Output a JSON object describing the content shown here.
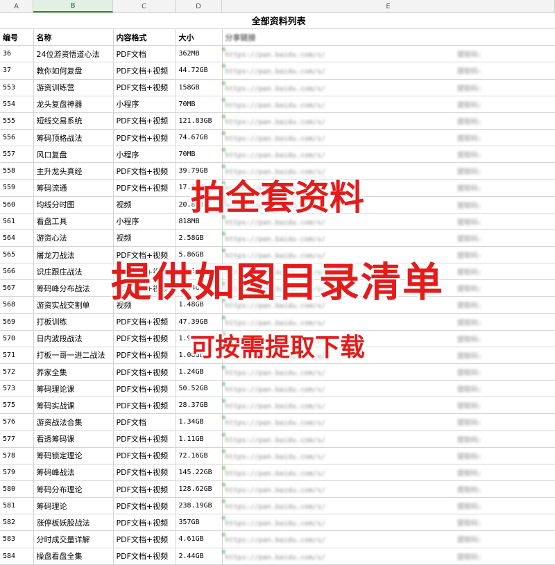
{
  "sheet": {
    "column_headers": [
      "A",
      "B",
      "C",
      "D",
      "E"
    ],
    "selected_column": "B",
    "title": "全部资料列表",
    "headers": [
      "编号",
      "名称",
      "内容格式",
      "大小",
      "分享链接"
    ],
    "link_prefix": "https://pan.baidu.com/s/",
    "code_label": "提取码:",
    "rows": [
      [
        "36",
        "24位游资悟道心法",
        "PDF文档",
        "362MB"
      ],
      [
        "37",
        "教你如何复盘",
        "PDF文档+视频",
        "44.72GB"
      ],
      [
        "553",
        "游资训练营",
        "PDF文档+视频",
        "158GB"
      ],
      [
        "554",
        "龙头复盘神器",
        "小程序",
        "70MB"
      ],
      [
        "555",
        "短线交易系统",
        "PDF文档+视频",
        "121.83GB"
      ],
      [
        "556",
        "筹码顶格战法",
        "PDF文档+视频",
        "74.67GB"
      ],
      [
        "557",
        "风口复盘",
        "小程序",
        "70MB"
      ],
      [
        "558",
        "主升龙头真经",
        "PDF文档+视频",
        "39.79GB"
      ],
      [
        "559",
        "筹码流通",
        "PDF文档+视频",
        "17.4GB"
      ],
      [
        "560",
        "均线分时图",
        "视频",
        "20.8GB"
      ],
      [
        "561",
        "看盘工具",
        "小程序",
        "818MB"
      ],
      [
        "564",
        "游资心法",
        "视频",
        "2.58GB"
      ],
      [
        "565",
        "屠龙刀战法",
        "PDF文档+视频",
        "5.86GB"
      ],
      [
        "566",
        "识庄跟庄战法",
        "PDF文档+视频",
        "92.3GB"
      ],
      [
        "567",
        "筹码峰分布战法",
        "PDF文档+视频",
        "12.4GB"
      ],
      [
        "568",
        "游资实战交割单",
        "视频",
        "1.48GB"
      ],
      [
        "569",
        "打板训练",
        "PDF文档+视频",
        "47.39GB"
      ],
      [
        "570",
        "日内波段战法",
        "PDF文档+视频",
        "1.97GB"
      ],
      [
        "571",
        "打板一哥一进二战法",
        "PDF文档+视频",
        "1.08GB"
      ],
      [
        "572",
        "养家全集",
        "PDF文档+视频",
        "1.24GB"
      ],
      [
        "573",
        "筹码理论课",
        "PDF文档+视频",
        "50.52GB"
      ],
      [
        "575",
        "筹码实战课",
        "PDF文档+视频",
        "28.37GB"
      ],
      [
        "576",
        "游资战法合集",
        "PDF文档",
        "1.34GB"
      ],
      [
        "577",
        "看透筹码课",
        "PDF文档+视频",
        "1.11GB"
      ],
      [
        "578",
        "筹码锁定理论",
        "PDF文档+视频",
        "72.16GB"
      ],
      [
        "579",
        "筹码峰战法",
        "PDF文档+视频",
        "145.22GB"
      ],
      [
        "580",
        "筹码分布理论",
        "PDF文档+视频",
        "128.62GB"
      ],
      [
        "581",
        "筹码理论",
        "PDF文档+视频",
        "238.19GB"
      ],
      [
        "582",
        "涨停板妖股战法",
        "PDF文档+视频",
        "357GB"
      ],
      [
        "583",
        "分时成交量详解",
        "PDF文档+视频",
        "4.61GB"
      ],
      [
        "584",
        "操盘看盘全集",
        "PDF文档+视频",
        "2.44GB"
      ]
    ]
  },
  "overlay": {
    "line1": "拍全套资料",
    "line2": "提供如图目录清单",
    "line3": "可按需提取下载"
  },
  "colors": {
    "overlay_text": "#e41b1b",
    "selected_column": "#2e8b43",
    "gridline": "#d4d4d4"
  }
}
